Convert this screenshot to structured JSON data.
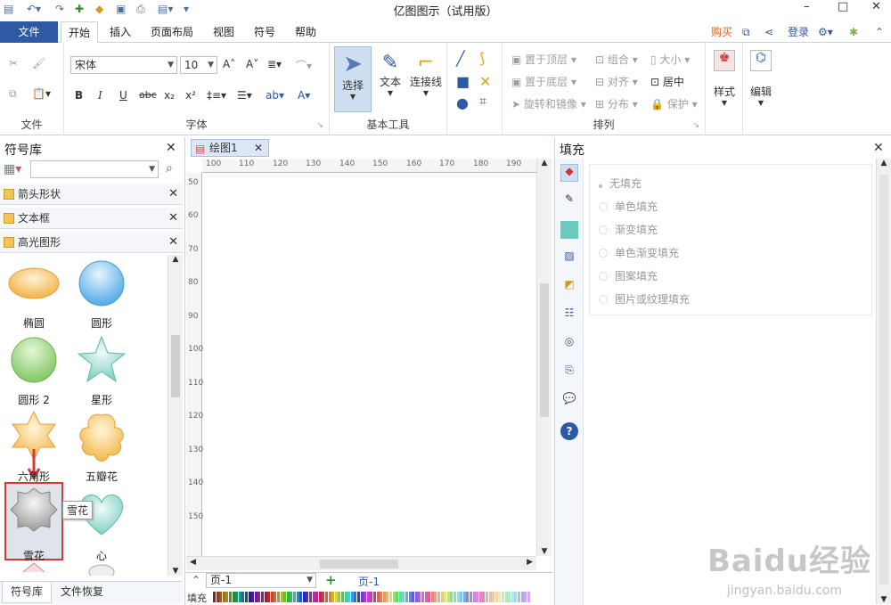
{
  "window": {
    "title": "亿图图示（试用版）",
    "minimize": "–",
    "maximize": "□",
    "close": "✕"
  },
  "menu": {
    "file": "文件",
    "tabs": [
      "开始",
      "插入",
      "页面布局",
      "视图",
      "符号",
      "帮助"
    ],
    "buy": "购买",
    "login": "登录"
  },
  "ribbon": {
    "groups": {
      "file": "文件",
      "font": "字体",
      "basic_tools": "基本工具",
      "arrange": "排列"
    },
    "font_name": "宋体",
    "font_size": "10",
    "format_buttons": [
      "B",
      "I",
      "U",
      "abc",
      "x₂",
      "x²"
    ],
    "tools": {
      "select": "选择",
      "text": "文本",
      "connector": "连接线"
    },
    "arrange_items": [
      "置于顶层",
      "置于底层",
      "旋转和镜像",
      "组合",
      "对齐",
      "分布",
      "大小",
      "居中",
      "保护"
    ],
    "style": "样式",
    "edit": "编辑"
  },
  "symbol_library": {
    "title": "符号库",
    "search_placeholder": "",
    "categories": [
      "箭头形状",
      "文本框",
      "高光图形"
    ],
    "shapes": [
      "椭圆",
      "圆形",
      "圆形 2",
      "星形",
      "六角形",
      "五瓣花",
      "雪花",
      "心"
    ],
    "tooltip": "雪花",
    "bottom_tabs": [
      "符号库",
      "文件恢复"
    ]
  },
  "document": {
    "tab": "绘图1",
    "ruler_h": [
      "100",
      "110",
      "120",
      "130",
      "140",
      "150",
      "160",
      "170",
      "180",
      "190"
    ],
    "ruler_v": [
      "50",
      "60",
      "70",
      "80",
      "90",
      "100",
      "110",
      "120",
      "130",
      "140",
      "150"
    ],
    "page_select": "页-1",
    "page_tab": "页-1",
    "fill_label": "填充"
  },
  "fill_panel": {
    "title": "填充",
    "options": [
      "无填充",
      "单色填充",
      "渐变填充",
      "单色渐变填充",
      "图案填充",
      "图片或纹理填充"
    ]
  },
  "watermark": {
    "brand": "Baidu经验",
    "url": "jingyan.baidu.com"
  },
  "colors": {
    "accent": "#2e5aa5",
    "buy": "#e0621c"
  }
}
